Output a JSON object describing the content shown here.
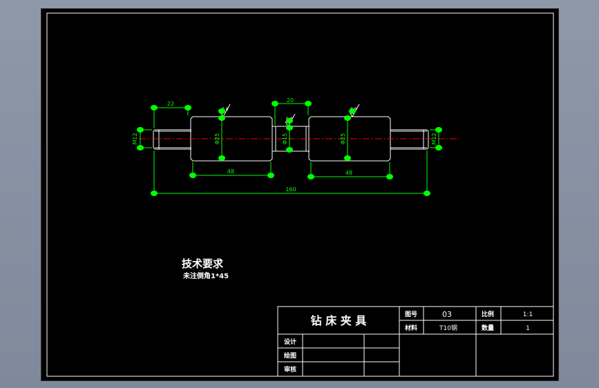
{
  "drawing": {
    "dimensions": {
      "d_left_len": "22",
      "d_groove": "20",
      "d_left_body": "48",
      "d_right_body": "48",
      "d_total": "160",
      "d_m12_left": "M12",
      "d_phi25_left": "Φ25",
      "d_phi15": "Φ15",
      "d_phi25_right": "Φ25",
      "d_m12_right": "M12"
    },
    "surface_marks": {
      "finish": "0.8"
    }
  },
  "notes": {
    "title": "技术要求",
    "line1": "未注倒角1*45"
  },
  "title_block": {
    "part_name": "钻 床 夹 具",
    "drawing_no_label": "图号",
    "drawing_no": "03",
    "scale_label": "比例",
    "scale": "1:1",
    "material_label": "材料",
    "material": "T10钢",
    "quantity_label": "数量",
    "quantity": "1",
    "design_label": "设计",
    "draw_label": "绘图",
    "review_label": "审核"
  },
  "colors": {
    "background": "#000000",
    "dimension": "#00ff00",
    "outline": "#ffffff",
    "centerline": "#ff0000"
  }
}
